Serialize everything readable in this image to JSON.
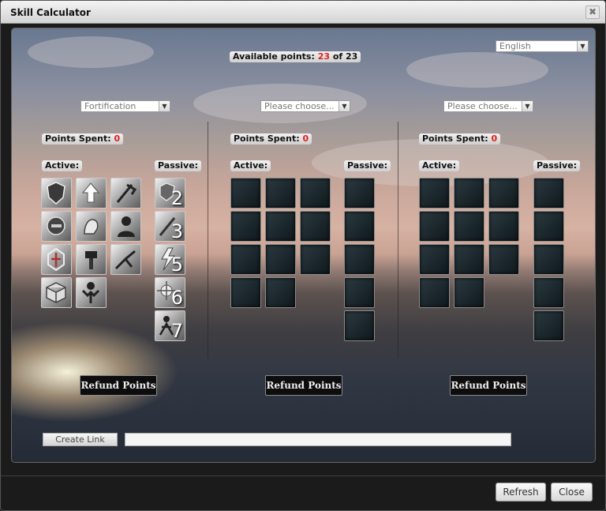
{
  "window": {
    "title": "Skill Calculator",
    "close_glyph": "✖"
  },
  "header": {
    "available_label": "Available points:",
    "available_current": "23",
    "available_of": "of 23",
    "language": "English"
  },
  "columns": [
    {
      "select": "Fortification",
      "points_spent_label": "Points Spent:",
      "points_spent": "0",
      "active_label": "Active:",
      "passive_label": "Passive:",
      "active_icons": [
        "shield-icon",
        "up-arrow-icon",
        "axe-strike-icon",
        "helmet-icon",
        "fist-icon",
        "silhouette-icon",
        "emblem-icon",
        "hammer-icon",
        "leap-icon",
        "cube-icon",
        "flex-icon"
      ],
      "passive_icons": [
        {
          "name": "passive-shield-icon",
          "num": "2"
        },
        {
          "name": "passive-blade-icon",
          "num": "3"
        },
        {
          "name": "passive-lightning-icon",
          "num": "5"
        },
        {
          "name": "passive-burst-icon",
          "num": "6"
        },
        {
          "name": "passive-figure-icon",
          "num": "7"
        }
      ],
      "refund_label": "Refund Points"
    },
    {
      "select": "Please choose...",
      "points_spent_label": "Points Spent:",
      "points_spent": "0",
      "active_label": "Active:",
      "passive_label": "Passive:",
      "refund_label": "Refund Points"
    },
    {
      "select": "Please choose...",
      "points_spent_label": "Points Spent:",
      "points_spent": "0",
      "active_label": "Active:",
      "passive_label": "Passive:",
      "refund_label": "Refund Points"
    }
  ],
  "link": {
    "create_label": "Create Link",
    "value": ""
  },
  "footer": {
    "refresh": "Refresh",
    "close": "Close"
  },
  "colors": {
    "accent_red": "#e02020",
    "slot_dark": "#1a262b"
  }
}
